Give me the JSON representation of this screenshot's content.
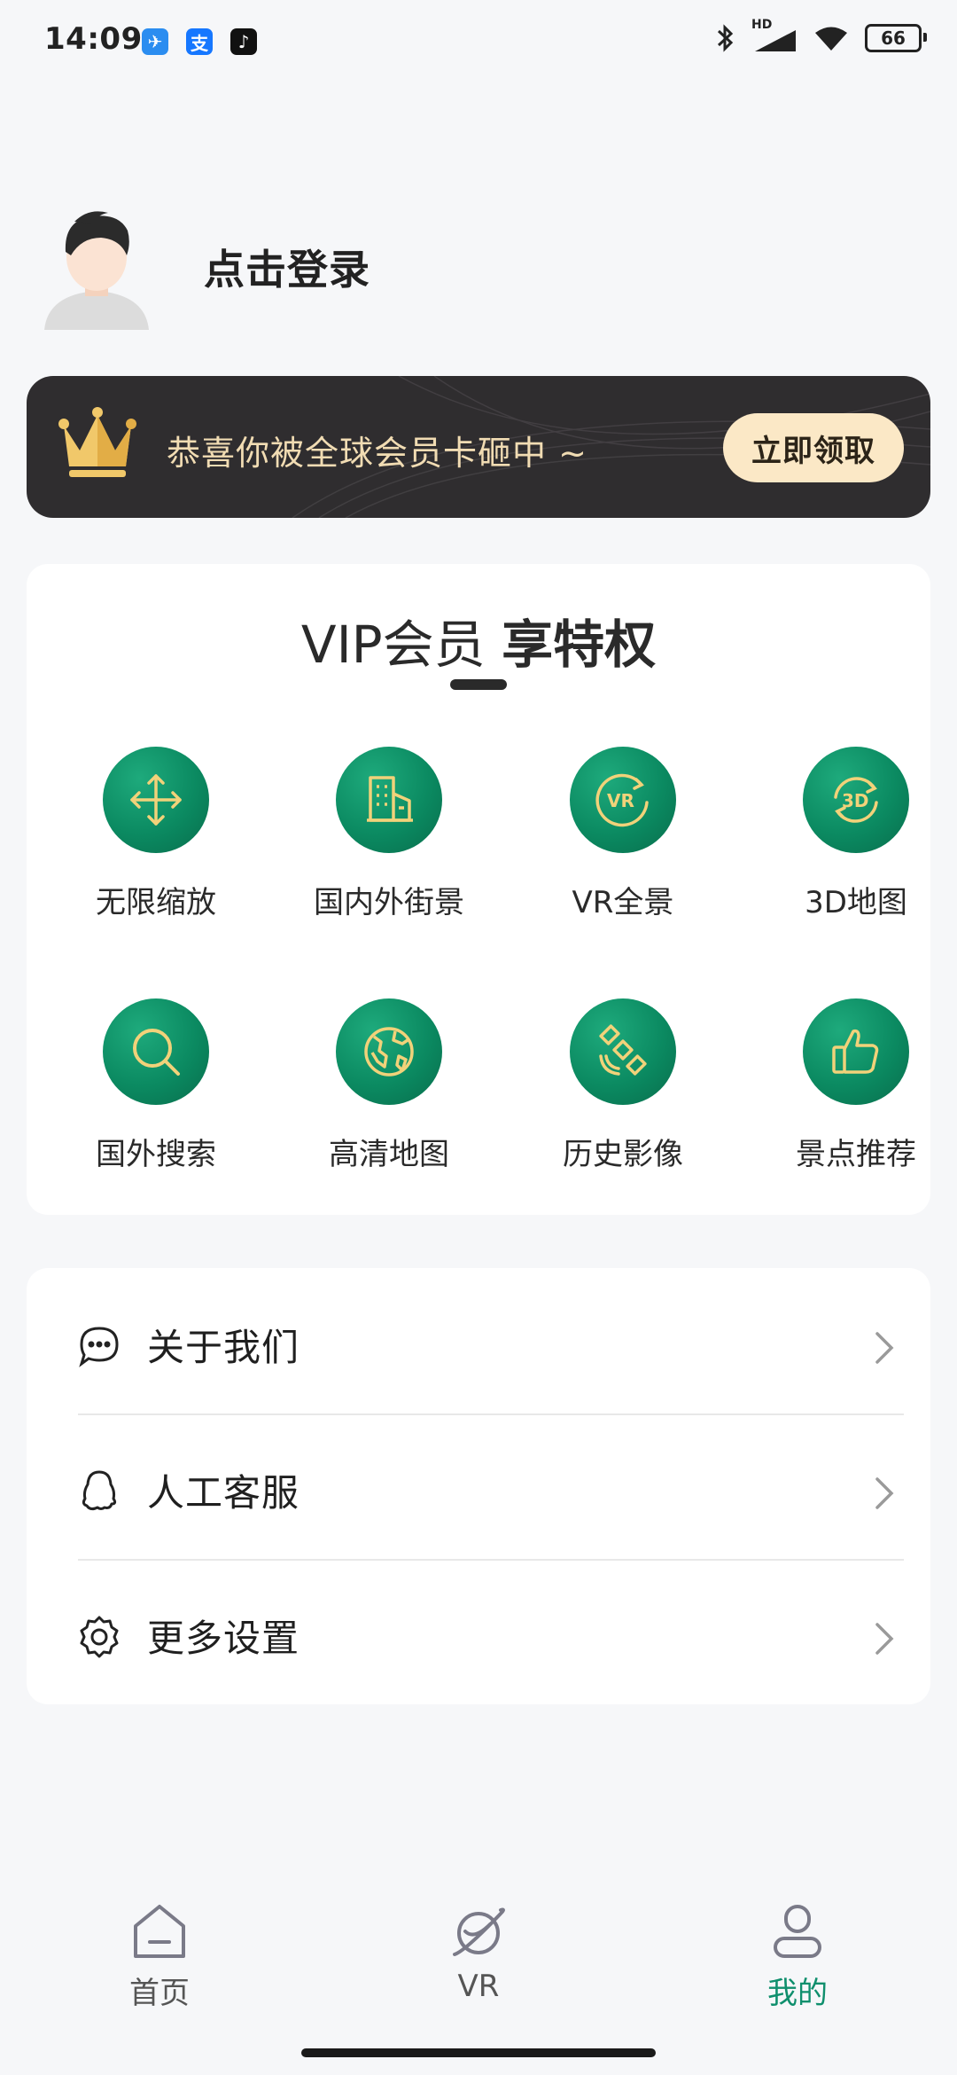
{
  "status_bar": {
    "time": "14:09",
    "network": "HD",
    "battery": "66",
    "app_icons": [
      "messenger-icon",
      "alipay-icon",
      "tiktok-icon"
    ]
  },
  "profile": {
    "login_text": "点击登录"
  },
  "banner": {
    "text": "恭喜你被全球会员卡砸中 ~",
    "button_label": "立即领取",
    "icon": "crown-icon"
  },
  "vip": {
    "title_part1": "VIP会员",
    "title_part2": "享特权",
    "features": [
      {
        "label": "无限缩放",
        "icon": "zoom-arrows-icon"
      },
      {
        "label": "国内外街景",
        "icon": "building-icon"
      },
      {
        "label": "VR全景",
        "icon": "vr-icon"
      },
      {
        "label": "3D地图",
        "icon": "3d-rotate-icon"
      },
      {
        "label": "国外搜索",
        "icon": "search-icon"
      },
      {
        "label": "高清地图",
        "icon": "globe-icon"
      },
      {
        "label": "历史影像",
        "icon": "satellite-icon"
      },
      {
        "label": "景点推荐",
        "icon": "thumbs-up-icon"
      }
    ]
  },
  "menu": {
    "items": [
      {
        "label": "关于我们",
        "icon": "chat-bubble-icon"
      },
      {
        "label": "人工客服",
        "icon": "support-icon"
      },
      {
        "label": "更多设置",
        "icon": "gear-icon"
      }
    ]
  },
  "nav": {
    "items": [
      {
        "label": "首页",
        "icon": "home-icon",
        "active": false
      },
      {
        "label": "VR",
        "icon": "planet-icon",
        "active": false
      },
      {
        "label": "我的",
        "icon": "user-icon",
        "active": true
      }
    ]
  },
  "colors": {
    "accent": "#0f8f6d",
    "banner_bg": "#2f2d2f",
    "banner_text": "#f1dcb3",
    "button_bg": "#fbe8c6",
    "feature_green": "#0b8a61",
    "gold": "#f1d27a"
  }
}
